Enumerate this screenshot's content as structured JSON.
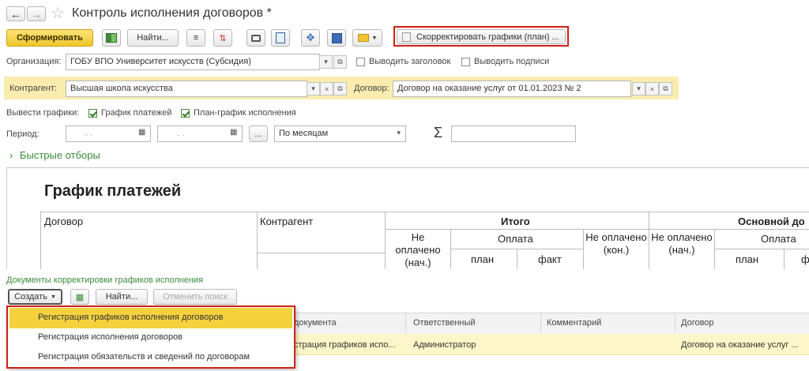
{
  "window": {
    "title": "Контроль исполнения договоров *"
  },
  "toolbar": {
    "generate": "Сформировать",
    "find": "Найти...",
    "adjust_schedules": "Скорректировать графики (план) ..."
  },
  "org": {
    "label": "Организация:",
    "value": "ГОБУ ВПО Университет искусств (Субсидия)",
    "show_header": "Выводить заголовок",
    "show_signatures": "Выводить подписи"
  },
  "contractor": {
    "label": "Контрагент:",
    "value": "Высшая школа искусства",
    "contract_label": "Договор:",
    "contract_value": "Договор на оказание услуг от 01.01.2023 № 2"
  },
  "graphs": {
    "label": "Вывести графики:",
    "payments": "График платежей",
    "plan": "План-график исполнения"
  },
  "period": {
    "label": "Период:",
    "from": ". .",
    "to": ". .",
    "more": "...",
    "granularity": "По месяцам",
    "sigma": "Σ"
  },
  "quick_filters": "Быстрые отборы",
  "report": {
    "title": "График платежей",
    "col_contract": "Договор",
    "col_contractor": "Контрагент",
    "group_total": "Итого",
    "group_main": "Основной до",
    "unpaid_start": "Не оплачено (нач.)",
    "payment": "Оплата",
    "plan": "план",
    "fact": "факт",
    "unpaid_end": "Не оплачено (кон.)",
    "unpaid_start_2": "Не оплачено (нач.)",
    "payment_2": "Оплата",
    "plan_2": "план",
    "fact_2": "ф"
  },
  "docs": {
    "title": "Документы корректировки графиков исполнения",
    "create": "Создать",
    "find": "Найти...",
    "cancel_search": "Отменить поиск"
  },
  "grid": {
    "headers": [
      "документа",
      "Ответственный",
      "Комментарий",
      "Договор"
    ],
    "row": [
      "страция графиков испо...",
      "Администратор",
      "",
      "Договор на оказание услуг ..."
    ]
  },
  "dropdown": {
    "items": [
      "Регистрация графиков исполнения договоров",
      "Регистрация исполнения договоров",
      "Регистрация обязательств и сведений по договорам"
    ]
  },
  "colors": {
    "accent_yellow": "#f5d13e",
    "highlight_row": "#fdf6c8",
    "red_outline": "#d0201a",
    "green_link": "#3c8a3c"
  }
}
